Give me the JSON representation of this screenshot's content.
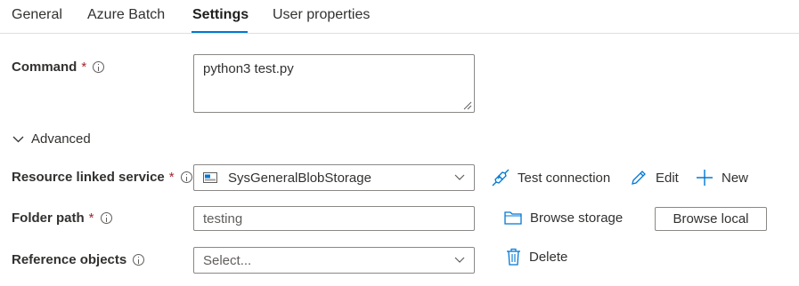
{
  "tabs": [
    {
      "label": "General"
    },
    {
      "label": "Azure Batch"
    },
    {
      "label": "Settings"
    },
    {
      "label": "User properties"
    }
  ],
  "active_tab": "Settings",
  "command": {
    "label": "Command",
    "required": "*",
    "value": "python3 test.py"
  },
  "advanced": {
    "label": "Advanced"
  },
  "resource_linked_service": {
    "label": "Resource linked service",
    "required": "*",
    "value": "SysGeneralBlobStorage"
  },
  "actions": {
    "test_connection": "Test connection",
    "edit": "Edit",
    "new": "New",
    "browse_storage": "Browse storage",
    "browse_local": "Browse local",
    "delete": "Delete"
  },
  "folder_path": {
    "label": "Folder path",
    "required": "*",
    "value": "testing"
  },
  "reference_objects": {
    "label": "Reference objects",
    "placeholder": "Select..."
  },
  "colors": {
    "accent": "#0078d4",
    "required": "#a4262c",
    "border": "#8a8886",
    "text": "#323130"
  }
}
